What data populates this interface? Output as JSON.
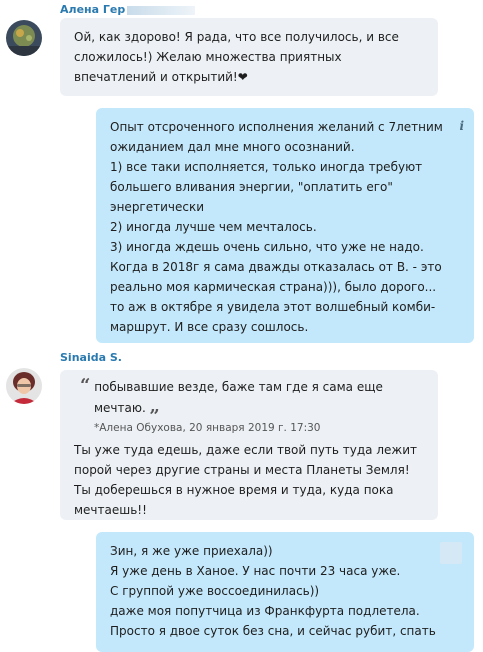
{
  "messages": [
    {
      "sender": "Алена Гер",
      "lines": [
        "Ой, как здорово! Я рада, что все получилось, и все",
        "сложилось!) Желаю множества приятных",
        "впечатлений и открытий!❤"
      ]
    },
    {
      "info_icon": "i",
      "lines": [
        "Опыт отсроченного исполнения желаний с 7летним",
        "ожиданием дал мне много осознаний.",
        "1) все таки исполняется, только иногда требуют",
        "большего вливания энергии, \"оплатить его\"",
        "энергетически",
        "2) иногда лучше чем мечталось.",
        "3) иногда ждешь очень сильно, что уже не надо.",
        "Когда в 2018г я сама дважды отказалась от В. - это",
        "реально моя кармическая страна))), было дорого...",
        "то аж в октябре я увидела этот волшебный комби-",
        "маршрут. И все сразу сошлось."
      ]
    },
    {
      "sender": "Sinaida S.",
      "quote": {
        "open_mark": "“",
        "close_mark": "„",
        "lines": [
          "побывавшие везде, баже там где я сама еще",
          "мечтаю."
        ],
        "meta": "*Алена Обухова, 20 января 2019 г. 17:30"
      },
      "lines": [
        "Ты уже туда едешь, даже если твой путь туда лежит",
        "порой через другие страны и места Планеты Земля!",
        "Ты доберешься в нужное время и туда, куда пока",
        "мечтаешь!!"
      ]
    },
    {
      "lines": [
        "Зин, я же уже приехала))",
        "Я уже день в Ханое. У нас почти 23 часа уже.",
        "С группой уже воссоединилась))",
        "даже моя попутчица из Франкфурта подлетела.",
        "Просто я двое суток без сна, и сейчас рубит, спать"
      ]
    }
  ]
}
